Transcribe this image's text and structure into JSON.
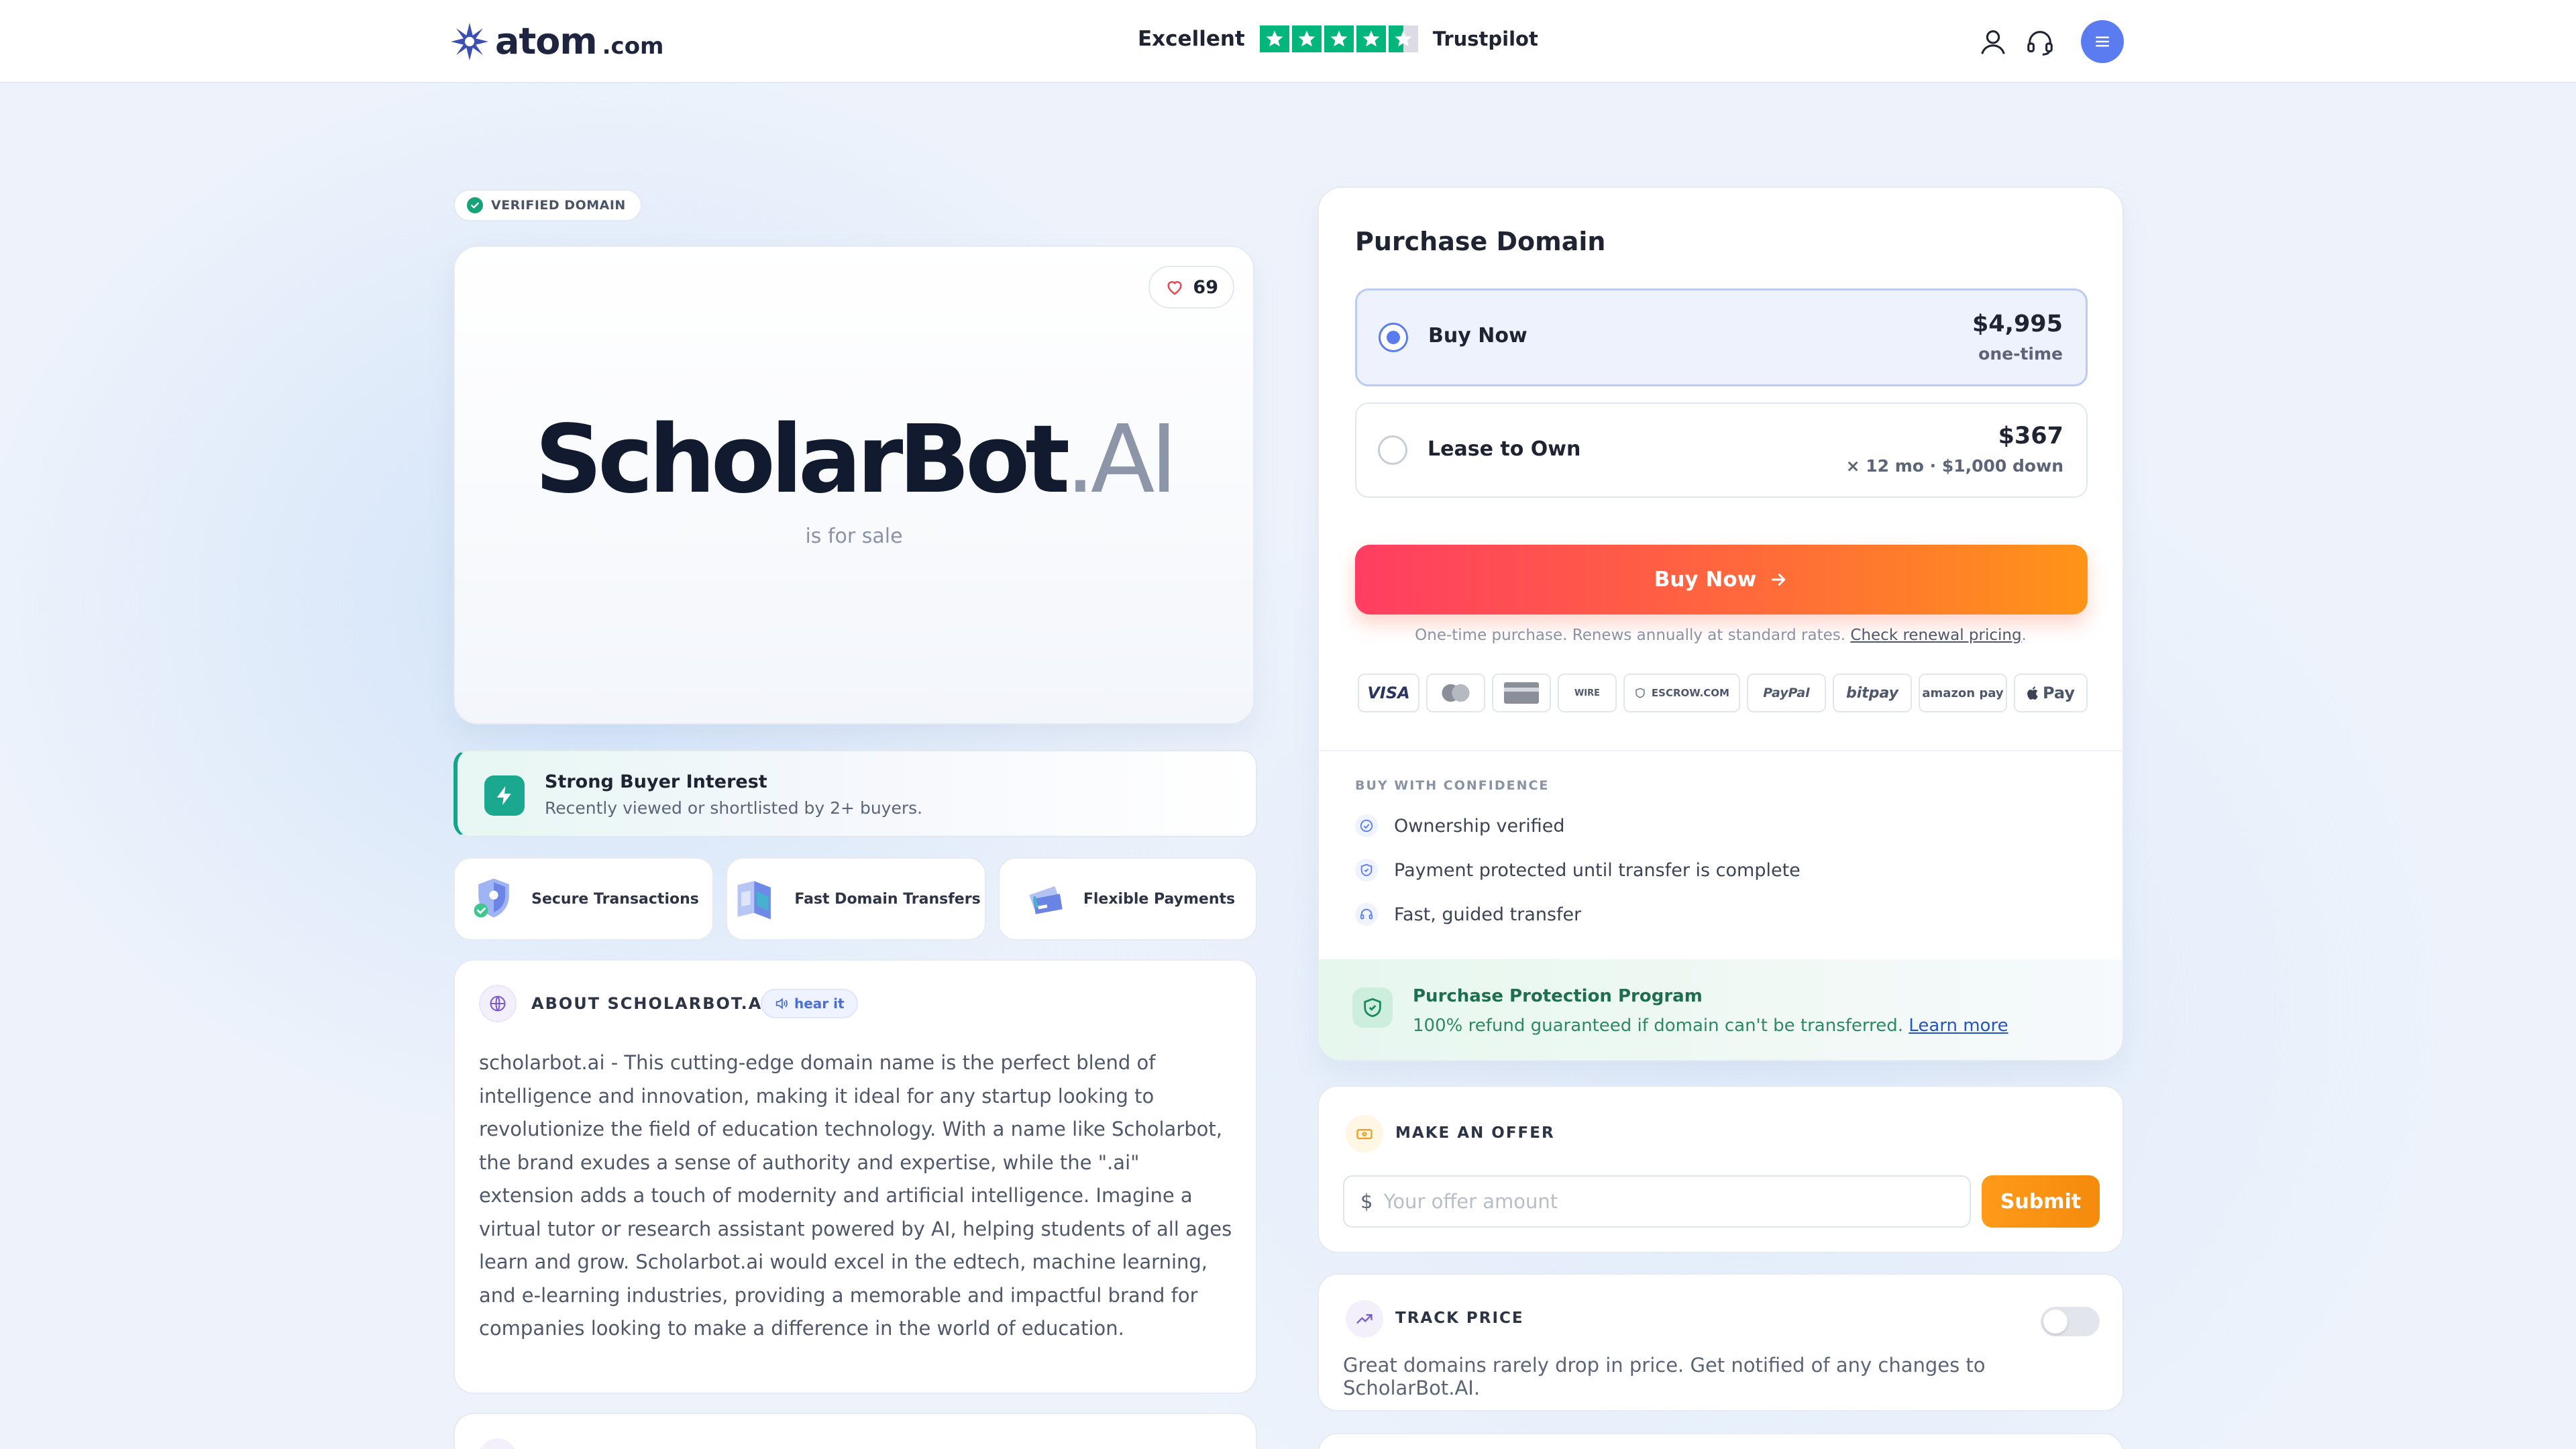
{
  "header": {
    "logo_text": "atom",
    "logo_suffix": ".com",
    "trust_label": "Excellent",
    "trust_brand": "Trustpilot",
    "trust_rating_stars": 4.5,
    "icons": [
      "account-icon",
      "support-headset-icon",
      "menu-icon"
    ]
  },
  "domain": {
    "verified_label": "VERIFIED DOMAIN",
    "name_main": "ScholarBot",
    "name_tld": ".AI",
    "subtitle": "is for sale",
    "likes": "69"
  },
  "interest": {
    "title": "Strong Buyer Interest",
    "subtitle": "Recently viewed or shortlisted by 2+ buyers."
  },
  "features": [
    {
      "label": "Secure Transactions",
      "icon": "shield-icon"
    },
    {
      "label": "Fast Domain Transfers",
      "icon": "transfer-icon"
    },
    {
      "label": "Flexible Payments",
      "icon": "payment-card-icon"
    }
  ],
  "about": {
    "title": "ABOUT SCHOLARBOT.AI",
    "hear_label": "hear it",
    "body": "scholarbot.ai - This cutting-edge domain name is the perfect blend of intelligence and innovation, making it ideal for any startup looking to revolutionize the field of education technology. With a name like Scholarbot, the brand exudes a sense of authority and expertise, while the \".ai\" extension adds a touch of modernity and artificial intelligence. Imagine a virtual tutor or research assistant powered by AI, helping students of all ages learn and grow. Scholarbot.ai would excel in the edtech, machine learning, and e-learning industries, providing a memorable and impactful brand for companies looking to make a difference in the world of education."
  },
  "purchase": {
    "title": "Purchase Domain",
    "options": [
      {
        "label": "Buy Now",
        "price": "$4,995",
        "note": "one-time",
        "selected": true
      },
      {
        "label": "Lease to Own",
        "price": "$367",
        "note": "× 12 mo · $1,000 down",
        "selected": false
      }
    ],
    "buy_button": "Buy Now",
    "buy_note": "One-time purchase. Renews annually at standard rates.",
    "buy_note_link": "Check renewal pricing",
    "buy_note_end": ".",
    "payment_methods": [
      "VISA",
      "Mastercard",
      "Card",
      "WIRE",
      "ESCROW.COM",
      "PayPal",
      "bitpay",
      "amazon pay",
      "Pay"
    ]
  },
  "confidence": {
    "title": "BUY WITH CONFIDENCE",
    "items": [
      "Ownership verified",
      "Payment protected until transfer is complete",
      "Fast, guided transfer"
    ]
  },
  "protection": {
    "title": "Purchase Protection Program",
    "subtitle": "100% refund guaranteed if domain can't be transferred.",
    "link": "Learn more"
  },
  "offer": {
    "title": "MAKE AN OFFER",
    "currency": "$",
    "placeholder": "Your offer amount",
    "submit": "Submit"
  },
  "track": {
    "title": "TRACK PRICE",
    "subtitle": "Great domains rarely drop in price. Get notified of any changes to ScholarBot.AI.",
    "enabled": false
  },
  "colors": {
    "accent": "#5b7cf0",
    "buy_gradient_start": "#ff3d62",
    "buy_gradient_end": "#ff9418",
    "trustpilot_green": "#00b67a",
    "success_green": "#16a37a"
  }
}
